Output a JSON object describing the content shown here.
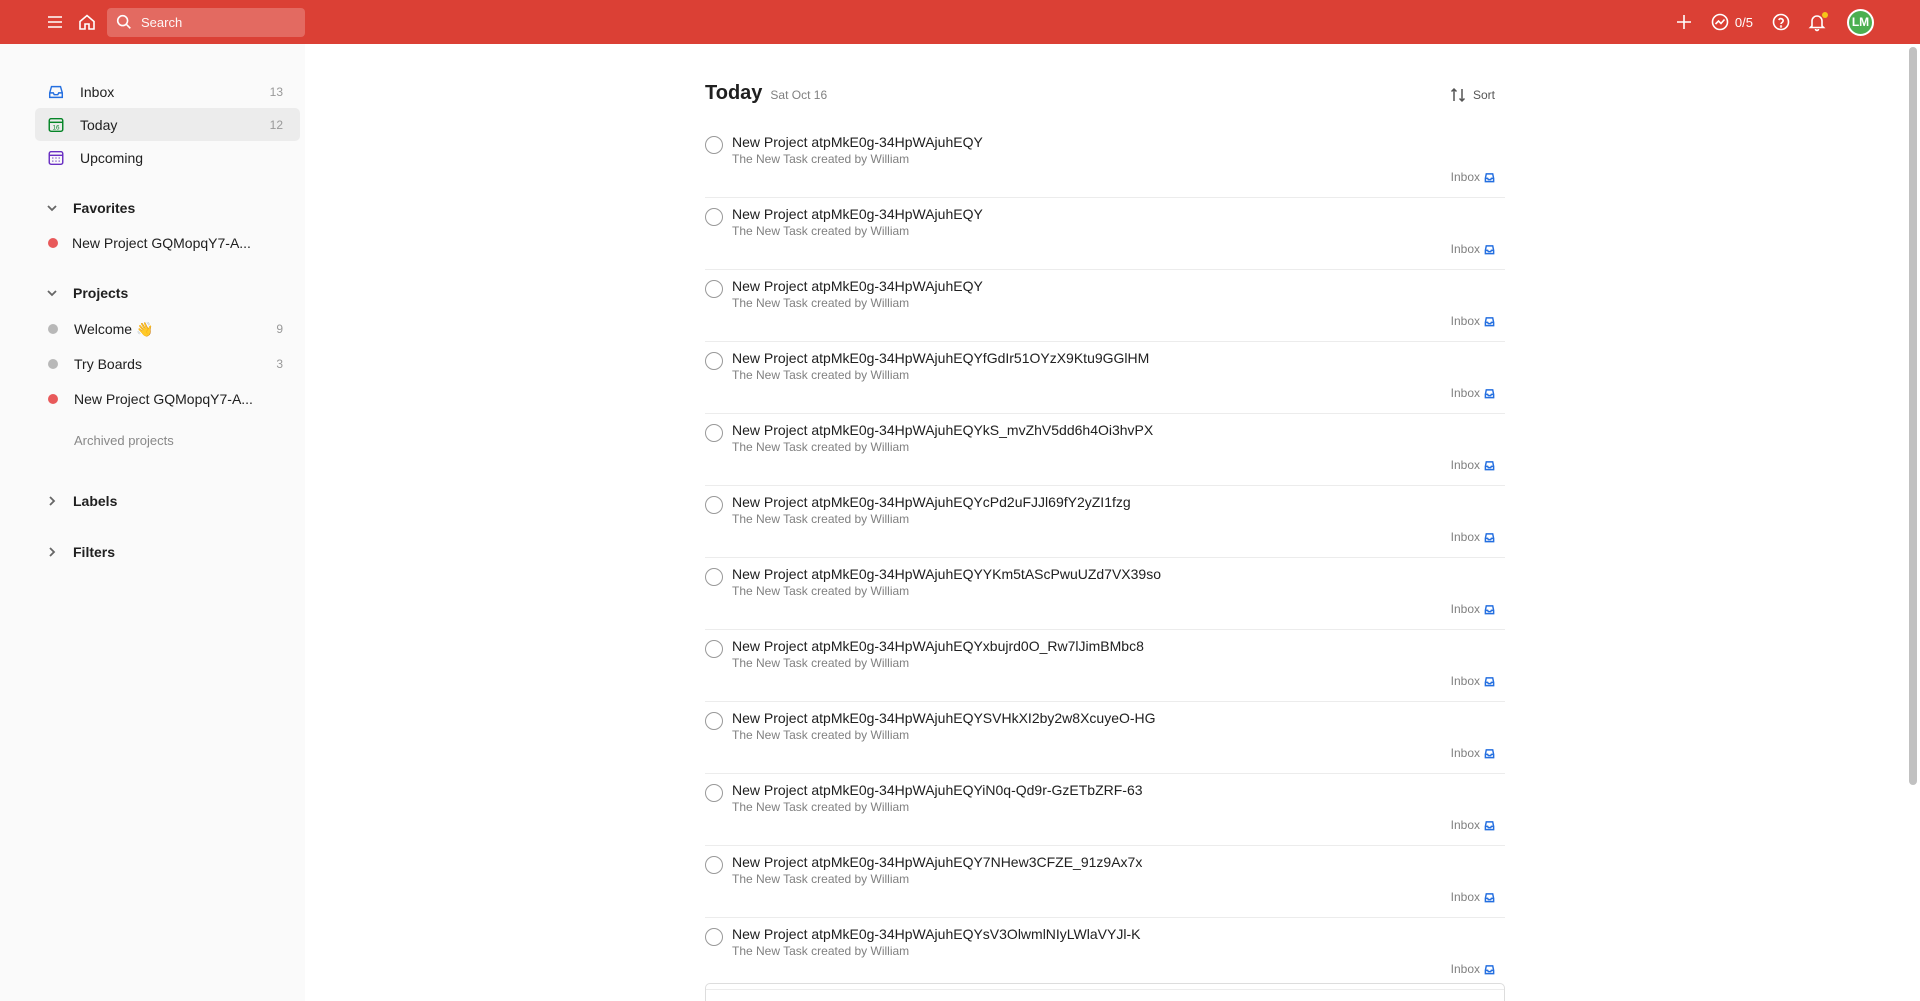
{
  "topbar": {
    "search_placeholder": "Search",
    "karma_label": "0/5",
    "avatar_initials": "LM",
    "accent_color": "#db4035"
  },
  "sidebar": {
    "nav": [
      {
        "label": "Inbox",
        "count": "13",
        "icon": "inbox-icon"
      },
      {
        "label": "Today",
        "count": "12",
        "icon": "calendar-today-icon"
      },
      {
        "label": "Upcoming",
        "count": "",
        "icon": "calendar-upcoming-icon"
      }
    ],
    "favorites": {
      "label": "Favorites",
      "items": [
        {
          "label": "New Project GQMopqY7-A...",
          "color": "#e8595a"
        }
      ]
    },
    "projects": {
      "label": "Projects",
      "items": [
        {
          "label": "Welcome 👋",
          "count": "9",
          "color": "#b8b8b8"
        },
        {
          "label": "Try Boards",
          "count": "3",
          "color": "#b8b8b8"
        },
        {
          "label": "New Project GQMopqY7-A...",
          "count": "",
          "color": "#e8595a"
        }
      ],
      "archived_label": "Archived projects"
    },
    "labels_label": "Labels",
    "filters_label": "Filters"
  },
  "main": {
    "title": "Today",
    "date": "Sat Oct 16",
    "sort_label": "Sort",
    "tasks": [
      {
        "title": "New Project atpMkE0g-34HpWAjuhEQY",
        "desc": "The New Task created by William",
        "project": "Inbox"
      },
      {
        "title": "New Project atpMkE0g-34HpWAjuhEQY",
        "desc": "The New Task created by William",
        "project": "Inbox"
      },
      {
        "title": "New Project atpMkE0g-34HpWAjuhEQY",
        "desc": "The New Task created by William",
        "project": "Inbox"
      },
      {
        "title": "New Project atpMkE0g-34HpWAjuhEQYfGdIr51OYzX9Ktu9GGlHM",
        "desc": "The New Task created by William",
        "project": "Inbox"
      },
      {
        "title": "New Project atpMkE0g-34HpWAjuhEQYkS_mvZhV5dd6h4Oi3hvPX",
        "desc": "The New Task created by William",
        "project": "Inbox"
      },
      {
        "title": "New Project atpMkE0g-34HpWAjuhEQYcPd2uFJJl69fY2yZI1fzg",
        "desc": "The New Task created by William",
        "project": "Inbox"
      },
      {
        "title": "New Project atpMkE0g-34HpWAjuhEQYYKm5tAScPwuUZd7VX39so",
        "desc": "The New Task created by William",
        "project": "Inbox"
      },
      {
        "title": "New Project atpMkE0g-34HpWAjuhEQYxbujrd0O_Rw7lJimBMbc8",
        "desc": "The New Task created by William",
        "project": "Inbox"
      },
      {
        "title": "New Project atpMkE0g-34HpWAjuhEQYSVHkXI2by2w8XcuyeO-HG",
        "desc": "The New Task created by William",
        "project": "Inbox"
      },
      {
        "title": "New Project atpMkE0g-34HpWAjuhEQYiN0q-Qd9r-GzETbZRF-63",
        "desc": "The New Task created by William",
        "project": "Inbox"
      },
      {
        "title": "New Project atpMkE0g-34HpWAjuhEQY7NHew3CFZE_91z9Ax7x",
        "desc": "The New Task created by William",
        "project": "Inbox"
      },
      {
        "title": "New Project atpMkE0g-34HpWAjuhEQYsV3OlwmlNIyLWlaVYJl-K",
        "desc": "The New Task created by William",
        "project": "Inbox"
      }
    ]
  }
}
